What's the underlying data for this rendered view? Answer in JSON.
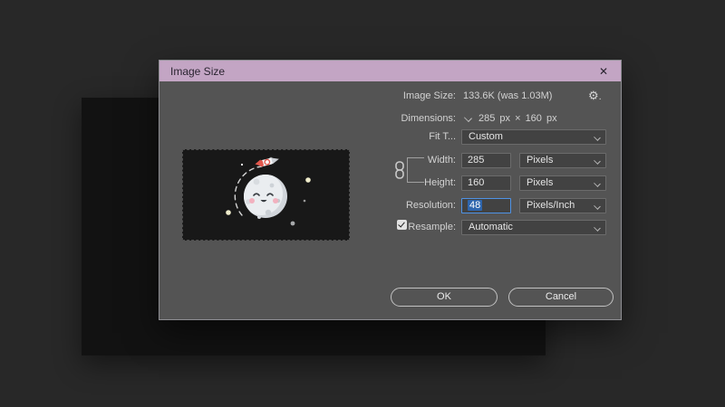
{
  "window": {
    "title": "Image Size",
    "close_glyph": "✕"
  },
  "icons": {
    "gear": "⚙",
    "gear_menu_dot": ".",
    "moon_preview": "cartoon moon with rocket orbit on starry background"
  },
  "header": {
    "label": "Image Size:",
    "value": "133.6K (was 1.03M)"
  },
  "dimensions": {
    "label": "Dimensions:",
    "value": "285 px  ×  160 px"
  },
  "fit_to": {
    "label": "Fit T...",
    "value": "Custom"
  },
  "width": {
    "label": "Width:",
    "value": "285",
    "unit": "Pixels"
  },
  "height": {
    "label": "Height:",
    "value": "160",
    "unit": "Pixels"
  },
  "resolution": {
    "label": "Resolution:",
    "value": "48",
    "unit": "Pixels/Inch"
  },
  "resample": {
    "label": "Resample:",
    "value": "Automatic",
    "checked": true
  },
  "buttons": {
    "ok": "OK",
    "cancel": "Cancel"
  },
  "colors": {
    "titlebar": "#c3a5c4",
    "dialog_bg": "#545454",
    "field_bg": "#424242",
    "focus_blue": "#4f93e6",
    "selection_blue": "#2f66ad",
    "canvas_bg": "#121212",
    "preview_bg": "#181818"
  }
}
